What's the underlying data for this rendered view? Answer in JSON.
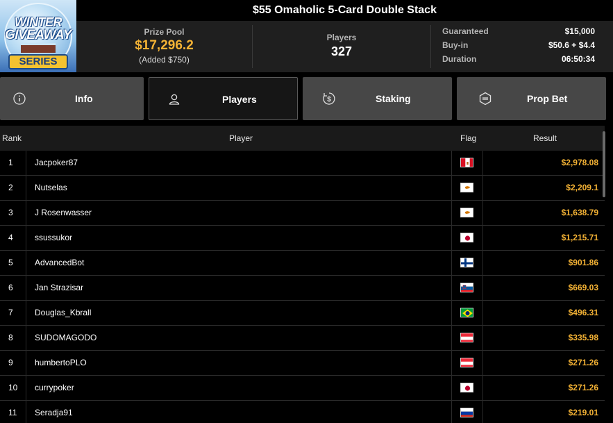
{
  "logo": {
    "line1": "WINTER",
    "line2": "GIVEAWAY",
    "line3": "SERIES"
  },
  "title": "$55 Omaholic 5-Card Double Stack",
  "prize_pool": {
    "label": "Prize Pool",
    "value": "$17,296.2",
    "added": "(Added $750)"
  },
  "players": {
    "label": "Players",
    "value": "327"
  },
  "info": [
    {
      "label": "Guaranteed",
      "value": "$15,000"
    },
    {
      "label": "Buy-in",
      "value": "$50.6 + $4.4"
    },
    {
      "label": "Duration",
      "value": "06:50:34"
    }
  ],
  "tabs": [
    {
      "label": "Info",
      "icon": "info-icon"
    },
    {
      "label": "Players",
      "icon": "user-icon"
    },
    {
      "label": "Staking",
      "icon": "dollar-coin-icon"
    },
    {
      "label": "Prop Bet",
      "icon": "bet-icon"
    }
  ],
  "active_tab": "Players",
  "table": {
    "headers": {
      "rank": "Rank",
      "player": "Player",
      "flag": "Flag",
      "result": "Result"
    },
    "rows": [
      {
        "rank": "1",
        "player": "Jacpoker87",
        "flag": "peru",
        "result": "$2,978.08"
      },
      {
        "rank": "2",
        "player": "Nutselas",
        "flag": "cyprus",
        "result": "$2,209.1"
      },
      {
        "rank": "3",
        "player": "J Rosenwasser",
        "flag": "cyprus",
        "result": "$1,638.79"
      },
      {
        "rank": "4",
        "player": "ssussukor",
        "flag": "japan",
        "result": "$1,215.71"
      },
      {
        "rank": "5",
        "player": "AdvancedBot",
        "flag": "finland",
        "result": "$901.86"
      },
      {
        "rank": "6",
        "player": "Jan Strazisar",
        "flag": "slovenia",
        "result": "$669.03"
      },
      {
        "rank": "7",
        "player": "Douglas_Kbrall",
        "flag": "brazil",
        "result": "$496.31"
      },
      {
        "rank": "8",
        "player": "SUDOMAGODO",
        "flag": "austria",
        "result": "$335.98"
      },
      {
        "rank": "9",
        "player": "humbertoPLO",
        "flag": "austria",
        "result": "$271.26"
      },
      {
        "rank": "10",
        "player": "currypoker",
        "flag": "japan",
        "result": "$271.26"
      },
      {
        "rank": "11",
        "player": "Seradja91",
        "flag": "russia",
        "result": "$219.01"
      }
    ]
  },
  "colors": {
    "accent": "#f5b335",
    "panel": "#1f1f1f",
    "tab": "#474747",
    "background": "#000000"
  }
}
